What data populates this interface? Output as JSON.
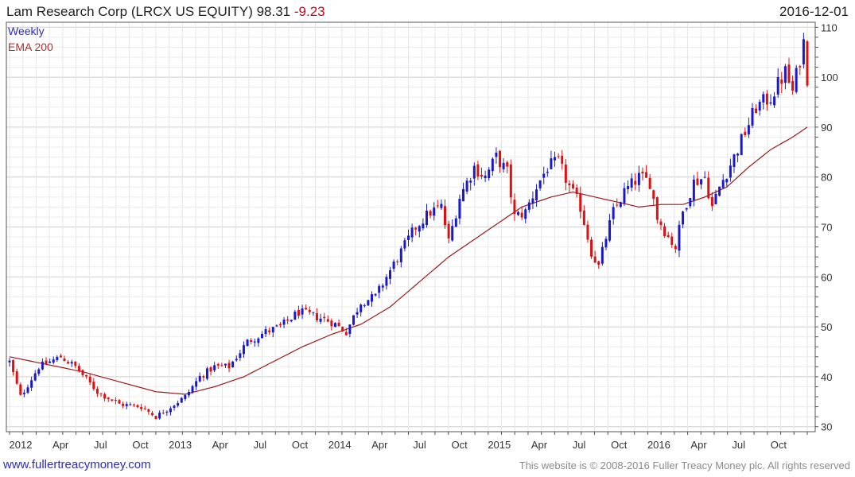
{
  "header": {
    "title": "Lam Research Corp (LRCX US EQUITY) 98.31",
    "change": "-9.23",
    "date": "2016-12-01"
  },
  "legend": {
    "weekly": "Weekly",
    "ema": "EMA 200"
  },
  "footer": {
    "link": "www.fullertreacymoney.com",
    "copyright": "This website is © 2008-2016 Fuller Treacy Money plc. All rights reserved"
  },
  "colors": {
    "up": "#1a1acc",
    "down": "#dd1111",
    "ema": "#a01818",
    "grid": "#e3e3e3",
    "frame": "#555555"
  },
  "chart_data": {
    "type": "candlestick",
    "frequency": "weekly",
    "x_range": [
      "2011-12",
      "2016-12"
    ],
    "ylim": [
      29,
      111
    ],
    "y_ticks": [
      30,
      40,
      50,
      60,
      70,
      80,
      90,
      100,
      110
    ],
    "x_ticks": [
      "2012",
      "Apr",
      "Jul",
      "Oct",
      "2013",
      "Apr",
      "Jul",
      "Oct",
      "2014",
      "Apr",
      "Jul",
      "Oct",
      "2015",
      "Apr",
      "Jul",
      "Oct",
      "2016",
      "Apr",
      "Jul",
      "Oct"
    ],
    "grid": true,
    "axis_position": "right",
    "price_anchors": [
      [
        0,
        43
      ],
      [
        3,
        36
      ],
      [
        8,
        42
      ],
      [
        14,
        44
      ],
      [
        18,
        42
      ],
      [
        24,
        37
      ],
      [
        30,
        34.5
      ],
      [
        36,
        34
      ],
      [
        40,
        32
      ],
      [
        44,
        34
      ],
      [
        48,
        36
      ],
      [
        52,
        40
      ],
      [
        56,
        42
      ],
      [
        60,
        42
      ],
      [
        65,
        47
      ],
      [
        70,
        49
      ],
      [
        74,
        50
      ],
      [
        79,
        53
      ],
      [
        84,
        52
      ],
      [
        88,
        51
      ],
      [
        92,
        49
      ],
      [
        96,
        55
      ],
      [
        100,
        56
      ],
      [
        103,
        60
      ],
      [
        107,
        65
      ],
      [
        111,
        70
      ],
      [
        115,
        73
      ],
      [
        118,
        74
      ],
      [
        120,
        67
      ],
      [
        123,
        76
      ],
      [
        127,
        82
      ],
      [
        130,
        80
      ],
      [
        133,
        84
      ],
      [
        136,
        81
      ],
      [
        138,
        72
      ],
      [
        141,
        73
      ],
      [
        144,
        78
      ],
      [
        147,
        82
      ],
      [
        150,
        83
      ],
      [
        153,
        78
      ],
      [
        156,
        74
      ],
      [
        159,
        65
      ],
      [
        161,
        62
      ],
      [
        163,
        68
      ],
      [
        165,
        73
      ],
      [
        168,
        77
      ],
      [
        172,
        80
      ],
      [
        175,
        79
      ],
      [
        177,
        72
      ],
      [
        180,
        68
      ],
      [
        182,
        66
      ],
      [
        184,
        73
      ],
      [
        187,
        79
      ],
      [
        190,
        80
      ],
      [
        192,
        74
      ],
      [
        194,
        78
      ],
      [
        198,
        84
      ],
      [
        201,
        89
      ],
      [
        204,
        94
      ],
      [
        208,
        96
      ],
      [
        212,
        101
      ],
      [
        214,
        97
      ],
      [
        217,
        107
      ],
      [
        218,
        98.31
      ]
    ],
    "ema_anchors": [
      [
        0,
        44
      ],
      [
        10,
        42.5
      ],
      [
        20,
        41
      ],
      [
        30,
        39
      ],
      [
        40,
        37
      ],
      [
        48,
        36.5
      ],
      [
        56,
        38
      ],
      [
        64,
        40
      ],
      [
        72,
        43
      ],
      [
        80,
        46
      ],
      [
        88,
        48.5
      ],
      [
        96,
        50.5
      ],
      [
        104,
        54
      ],
      [
        112,
        59
      ],
      [
        120,
        64
      ],
      [
        128,
        68
      ],
      [
        134,
        71
      ],
      [
        140,
        74
      ],
      [
        148,
        76
      ],
      [
        154,
        77
      ],
      [
        160,
        76
      ],
      [
        166,
        75
      ],
      [
        172,
        74
      ],
      [
        178,
        74.5
      ],
      [
        184,
        74.5
      ],
      [
        190,
        76
      ],
      [
        196,
        78
      ],
      [
        202,
        82
      ],
      [
        208,
        85.5
      ],
      [
        214,
        88
      ],
      [
        218,
        90
      ]
    ],
    "last_close": 98.31
  }
}
